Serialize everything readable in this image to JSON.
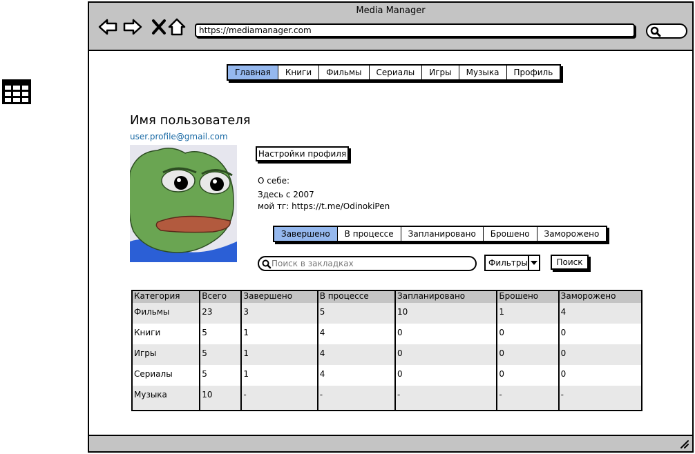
{
  "window": {
    "title": "Media Manager"
  },
  "browser": {
    "url": "https://mediamanager.com"
  },
  "nav": {
    "tabs": [
      {
        "label": "Главная",
        "active": true
      },
      {
        "label": "Книги",
        "active": false
      },
      {
        "label": "Фильмы",
        "active": false
      },
      {
        "label": "Сериалы",
        "active": false
      },
      {
        "label": "Игры",
        "active": false
      },
      {
        "label": "Музыка",
        "active": false
      },
      {
        "label": "Профиль",
        "active": false
      }
    ]
  },
  "profile": {
    "username": "Имя пользователя",
    "email": "user.profile@gmail.com",
    "settings_button": "Настройки профиля",
    "about_label": "О себе:",
    "about_lines": [
      "Здесь с 2007",
      "мой тг: https://t.me/OdinokiPen"
    ]
  },
  "status_tabs": [
    {
      "label": "Завершено",
      "active": true
    },
    {
      "label": "В процессе",
      "active": false
    },
    {
      "label": "Запланировано",
      "active": false
    },
    {
      "label": "Брошено",
      "active": false
    },
    {
      "label": "Заморожено",
      "active": false
    }
  ],
  "search": {
    "placeholder": "Поиск в закладках",
    "filter_label": "Фильтры",
    "button": "Поиск"
  },
  "table": {
    "headers": [
      "Категория",
      "Всего",
      "Завершено",
      "В процессе",
      "Запланировано",
      "Брошено",
      "Заморожено"
    ],
    "rows": [
      [
        "Фильмы",
        "23",
        "3",
        "5",
        "10",
        "1",
        "4"
      ],
      [
        "Книги",
        "5",
        "1",
        "4",
        "0",
        "0",
        "0"
      ],
      [
        "Игры",
        "5",
        "1",
        "4",
        "0",
        "0",
        "0"
      ],
      [
        "Сериалы",
        "5",
        "1",
        "4",
        "0",
        "0",
        "0"
      ],
      [
        "Музыка",
        "10",
        "-",
        "-",
        "-",
        "-",
        "-"
      ]
    ]
  },
  "colors": {
    "accent": "#95b8ee",
    "chrome": "#c4c4c4",
    "link": "#1a6aa5"
  }
}
